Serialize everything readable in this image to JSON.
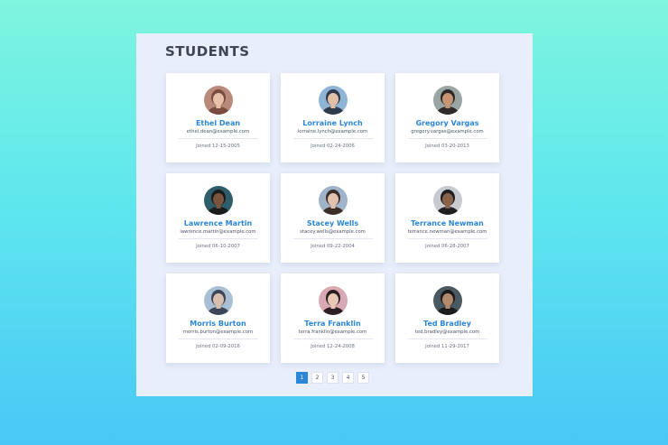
{
  "page": {
    "title": "STUDENTS"
  },
  "students": [
    {
      "name": "Ethel Dean",
      "email": "ethel.dean@example.com",
      "joined": "Joined 12-15-2005",
      "avatar_bg": "#b98a7a",
      "avatar_fg": "#7a4b3f",
      "skin": "#e7c1a9"
    },
    {
      "name": "Lorraine Lynch",
      "email": "lorraine.lynch@example.com",
      "joined": "Joined 02-24-2006",
      "avatar_bg": "#8fb4d6",
      "avatar_fg": "#2f3a4a",
      "skin": "#e2c0a8"
    },
    {
      "name": "Gregory Vargas",
      "email": "gregory.vargas@example.com",
      "joined": "Joined 03-20-2013",
      "avatar_bg": "#9aa6a4",
      "avatar_fg": "#2d2a27",
      "skin": "#c79676"
    },
    {
      "name": "Lawrence Martin",
      "email": "lawrence.martin@example.com",
      "joined": "Joined 06-10-2007",
      "avatar_bg": "#2f5d6a",
      "avatar_fg": "#1b1b1b",
      "skin": "#7a543f"
    },
    {
      "name": "Stacey Wells",
      "email": "stacey.wells@example.com",
      "joined": "Joined 09-22-2004",
      "avatar_bg": "#9fb3c9",
      "avatar_fg": "#3b2d28",
      "skin": "#e2c2ad"
    },
    {
      "name": "Terrance Newman",
      "email": "terrance.newman@example.com",
      "joined": "Joined 06-28-2007",
      "avatar_bg": "#c7cbd0",
      "avatar_fg": "#1f1f22",
      "skin": "#8a6249"
    },
    {
      "name": "Morris Burton",
      "email": "morris.burton@example.com",
      "joined": "Joined 02-09-2016",
      "avatar_bg": "#a9c0d4",
      "avatar_fg": "#3c4658",
      "skin": "#d8bfae"
    },
    {
      "name": "Terra Franklin",
      "email": "terra.franklin@example.com",
      "joined": "Joined 12-24-2008",
      "avatar_bg": "#d9a9b3",
      "avatar_fg": "#2b1f22",
      "skin": "#e9c8b6"
    },
    {
      "name": "Ted Bradley",
      "email": "ted.bradley@example.com",
      "joined": "Joined 11-29-2017",
      "avatar_bg": "#4a5a63",
      "avatar_fg": "#1e1c1a",
      "skin": "#b58a6c"
    }
  ],
  "pagination": {
    "pages": [
      "1",
      "2",
      "3",
      "4",
      "5"
    ],
    "active": "1"
  },
  "colors": {
    "accent": "#2c86d6",
    "title": "#3e4656",
    "panel": "#e8eefa"
  }
}
